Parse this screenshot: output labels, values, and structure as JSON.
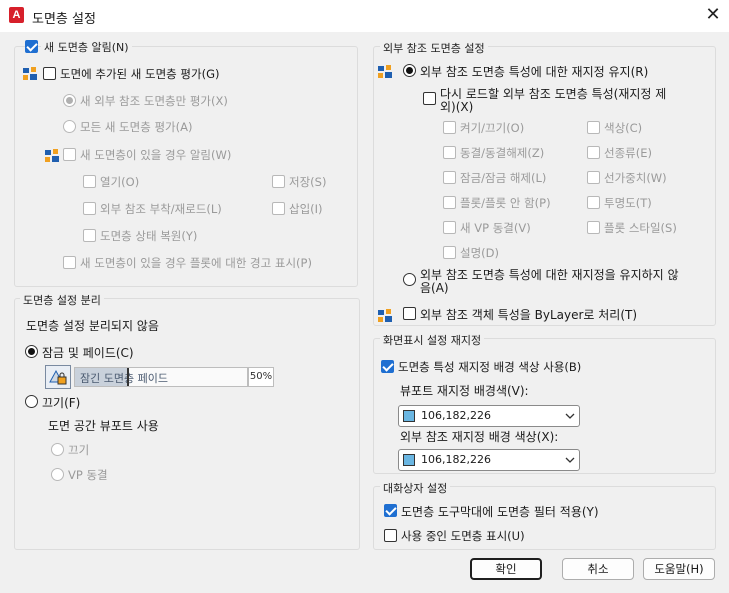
{
  "window": {
    "title": "도면층 설정",
    "app_letter": "A"
  },
  "new_layer": {
    "title": "새 도면층 알림(N)",
    "eval_added": "도면에 추가된 새 도면층 평가(G)",
    "eval_xref_only": "새 외부 참조 도면층만 평가(X)",
    "eval_all": "모든 새 도면층 평가(A)",
    "notify_title": "새 도면층이 있을 경우 알림(W)",
    "open": "열기(O)",
    "save": "저장(S)",
    "attach_reload": "외부 참조 부착/재로드(L)",
    "insert": "삽입(I)",
    "restore_state": "도면층 상태 복원(Y)",
    "plot_warning": "새 도면층이 있을 경우 플롯에 대한 경고 표시(P)"
  },
  "isolate": {
    "title": "도면층 설정 분리",
    "setting": "도면층 설정 분리되지 않음",
    "lock_fade": "잠금 및 페이드(C)",
    "fade_label": "잠긴 도면층 페이드",
    "fade_value": "50%",
    "fade_fraction": 0.5,
    "off": "끄기(F)",
    "paper_vp": "도면 공간 뷰포트 사용",
    "vp_off": "끄기",
    "vp_freeze": "VP 동결"
  },
  "xref": {
    "title": "외부 참조 도면층 설정",
    "keep": "외부 참조 도면층 특성에 대한 재지정 유지(R)",
    "reload_line1": "다시 로드할 외부 참조 도면층 특성(재지정 제",
    "reload_line2": "외)(X)",
    "props_left": [
      "켜기/끄기(O)",
      "동결/동결해제(Z)",
      "잠금/잠금 해제(L)",
      "플롯/플롯 안 함(P)",
      "새 VP 동결(V)",
      "설명(D)"
    ],
    "props_right": [
      "색상(C)",
      "선종류(E)",
      "선가중치(W)",
      "투명도(T)",
      "플롯 스타일(S)"
    ],
    "no_keep_line1": "외부 참조 도면층 특성에 대한 재지정을 유지하지 않",
    "no_keep_line2": "음(A)",
    "bylayer": "외부 참조 객체 특성을 ByLayer로 처리(T)"
  },
  "display": {
    "title": "화면표시 설정 재지정",
    "use_bg": "도면층 특성 재지정 배경 색상 사용(B)",
    "vp_label": "뷰포트 재지정 배경색(V):",
    "vp_color": "106,182,226",
    "xref_label": "외부 참조 재지정 배경 색상(X):",
    "xref_color": "106,182,226",
    "swatch_color": "#6ab6e2"
  },
  "dialog": {
    "title": "대화상자 설정",
    "filter_toolbar": "도면층 도구막대에 도면층 필터 적용(Y)",
    "show_in_use": "사용 중인 도면층 표시(U)"
  },
  "buttons": {
    "ok": "확인",
    "cancel": "취소",
    "help": "도움말(H)"
  }
}
